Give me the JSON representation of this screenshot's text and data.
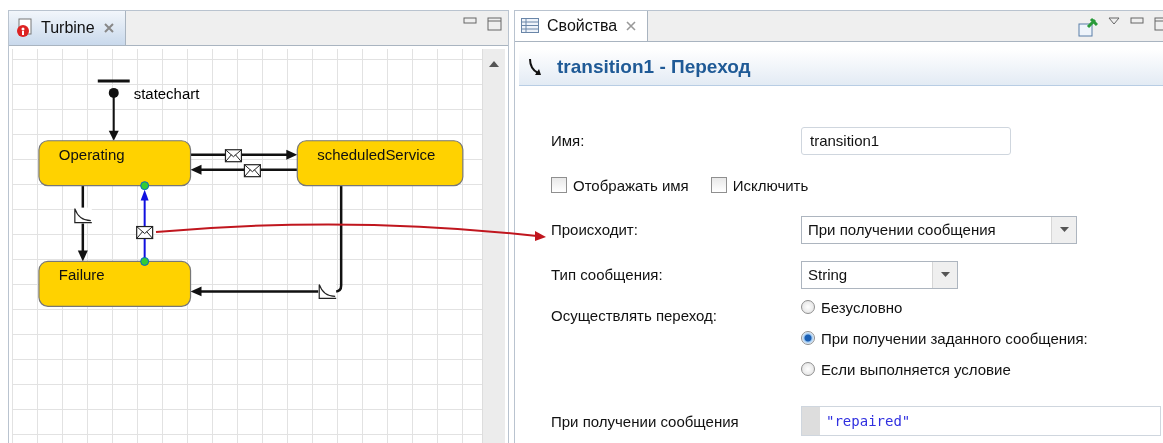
{
  "editor_tab": {
    "title": "Turbine"
  },
  "diagram": {
    "statechart_label": "statechart",
    "states": [
      {
        "name": "Operating"
      },
      {
        "name": "scheduledService"
      },
      {
        "name": "Failure"
      }
    ]
  },
  "properties_tab": {
    "title": "Свойства"
  },
  "properties": {
    "title": "transition1 - Переход",
    "name_field": {
      "label": "Имя:",
      "value": "transition1"
    },
    "checkboxes": [
      {
        "label": "Отображать имя",
        "checked": false
      },
      {
        "label": "Исключить",
        "checked": false
      }
    ],
    "trigger": {
      "label": "Происходит:",
      "value": "При получении сообщения"
    },
    "message_type": {
      "label": "Тип сообщения:",
      "value": "String"
    },
    "fire_mode": {
      "label": "Осуществлять переход:",
      "options": [
        {
          "label": "Безусловно",
          "selected": false
        },
        {
          "label": "При получении заданного сообщения:",
          "selected": true
        },
        {
          "label": "Если выполняется условие",
          "selected": false
        }
      ]
    },
    "message": {
      "label": "При получении сообщения",
      "value": "\"repaired\""
    }
  }
}
